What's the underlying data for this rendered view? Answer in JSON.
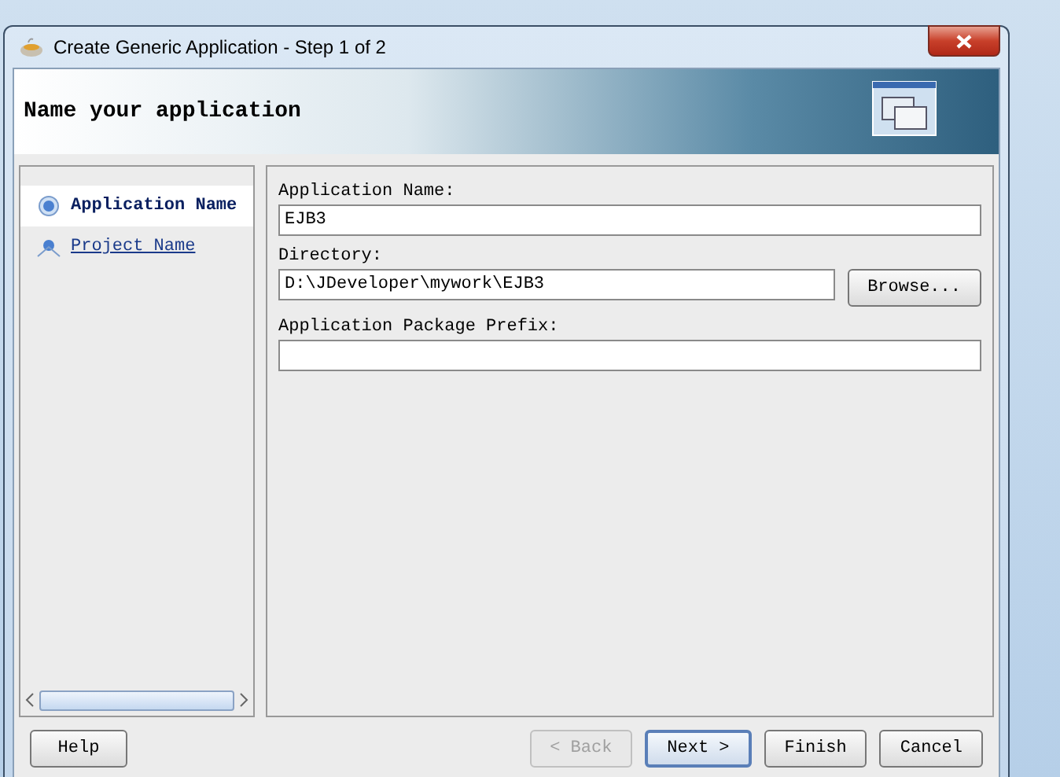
{
  "window": {
    "title": "Create Generic Application - Step 1 of 2"
  },
  "banner": {
    "title": "Name your application"
  },
  "steps": [
    {
      "label": "Application Name",
      "selected": true
    },
    {
      "label": "Project Name",
      "selected": false
    }
  ],
  "fields": [
    {
      "kind": "text",
      "label": "Application Name:",
      "value": "EJB3"
    },
    {
      "kind": "browse",
      "label": "Directory:",
      "value": "D:\\JDeveloper\\mywork\\EJB3",
      "button": "Browse..."
    },
    {
      "kind": "text",
      "label": "Application Package Prefix:"
    }
  ],
  "help_button": {
    "label": "Help"
  },
  "buttons": [
    {
      "label": "< Back",
      "disabled": true,
      "default": false
    },
    {
      "label": "Next >",
      "disabled": false,
      "default": true
    },
    {
      "label": "Finish",
      "disabled": false,
      "default": false
    },
    {
      "label": "Cancel",
      "disabled": false,
      "default": false
    }
  ]
}
